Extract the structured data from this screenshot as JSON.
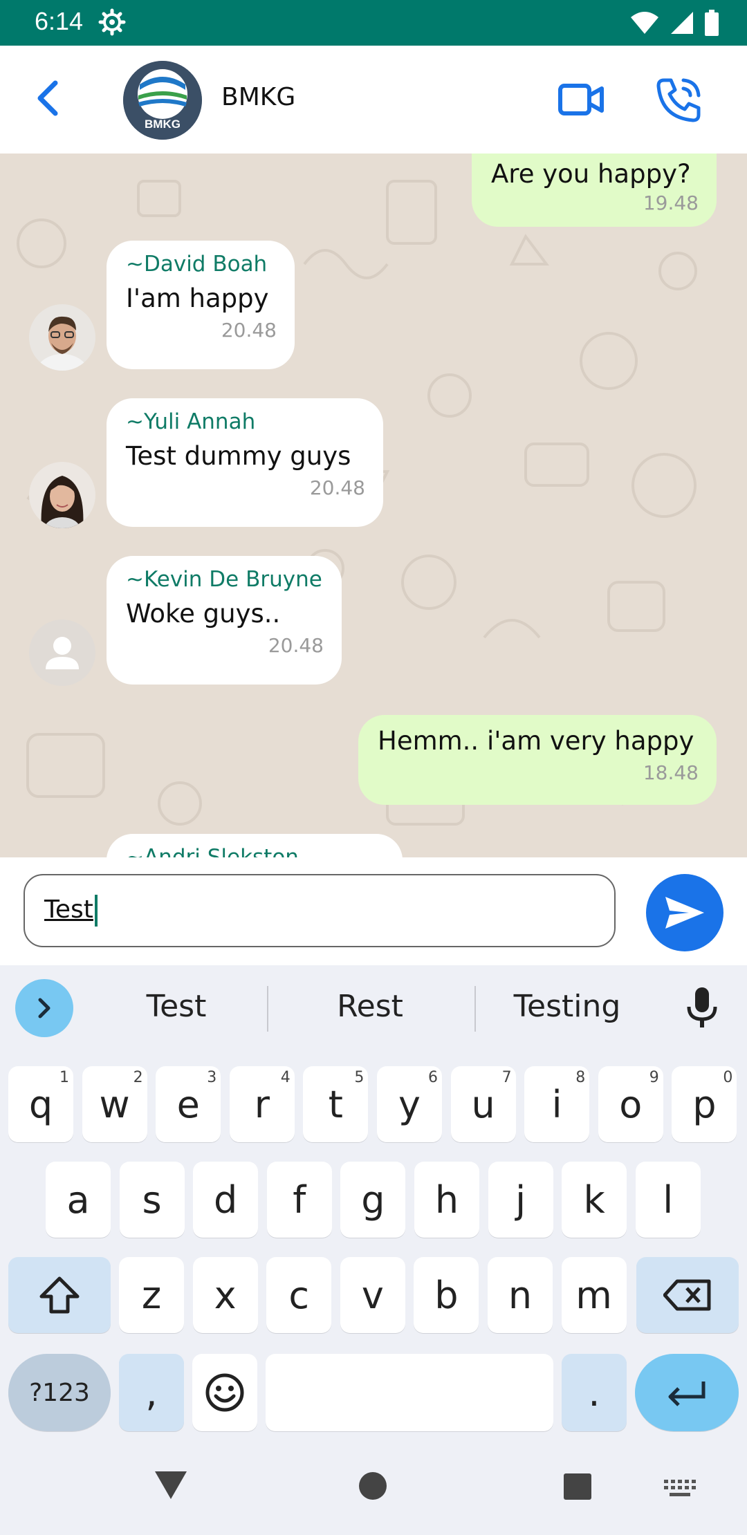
{
  "status_bar": {
    "time": "6:14"
  },
  "header": {
    "title": "BMKG",
    "avatar_text": "BMKG"
  },
  "chat": {
    "messages": [
      {
        "direction": "out",
        "text": "Are you happy?",
        "time": "19.48"
      },
      {
        "direction": "in",
        "sender": "~David Boah",
        "text": "I'am happy",
        "time": "20.48"
      },
      {
        "direction": "in",
        "sender": "~Yuli Annah",
        "text": "Test dummy guys",
        "time": "20.48"
      },
      {
        "direction": "in",
        "sender": "~Kevin De Bruyne",
        "text": "Woke guys..",
        "time": "20.48"
      },
      {
        "direction": "out",
        "text": "Hemm.. i'am very happy",
        "time": "18.48"
      },
      {
        "direction": "in",
        "sender": "~Andri Slekston",
        "text": "",
        "time": ""
      }
    ]
  },
  "composer": {
    "value": "Test"
  },
  "keyboard": {
    "suggestions": [
      "Test",
      "Rest",
      "Testing"
    ],
    "row1": [
      {
        "key": "q",
        "hint": "1"
      },
      {
        "key": "w",
        "hint": "2"
      },
      {
        "key": "e",
        "hint": "3"
      },
      {
        "key": "r",
        "hint": "4"
      },
      {
        "key": "t",
        "hint": "5"
      },
      {
        "key": "y",
        "hint": "6"
      },
      {
        "key": "u",
        "hint": "7"
      },
      {
        "key": "i",
        "hint": "8"
      },
      {
        "key": "o",
        "hint": "9"
      },
      {
        "key": "p",
        "hint": "0"
      }
    ],
    "row2": [
      "a",
      "s",
      "d",
      "f",
      "g",
      "h",
      "j",
      "k",
      "l"
    ],
    "row3": [
      "z",
      "x",
      "c",
      "v",
      "b",
      "n",
      "m"
    ],
    "symbols_label": "?123",
    "comma": ",",
    "period": "."
  },
  "colors": {
    "status_bar": "#00796b",
    "accent_blue": "#1a73e8",
    "sender_green": "#0f7b66",
    "outgoing_bubble": "#e1fbc8",
    "chat_background": "#e6ddd3"
  },
  "icons": [
    "gear-icon",
    "wifi-icon",
    "signal-icon",
    "battery-icon",
    "back-arrow-icon",
    "video-camera-icon",
    "phone-call-icon",
    "send-icon",
    "chevron-right-icon",
    "microphone-icon",
    "shift-icon",
    "backspace-icon",
    "emoji-icon",
    "enter-icon",
    "nav-back-icon",
    "nav-home-icon",
    "nav-recents-icon",
    "keyboard-icon"
  ]
}
